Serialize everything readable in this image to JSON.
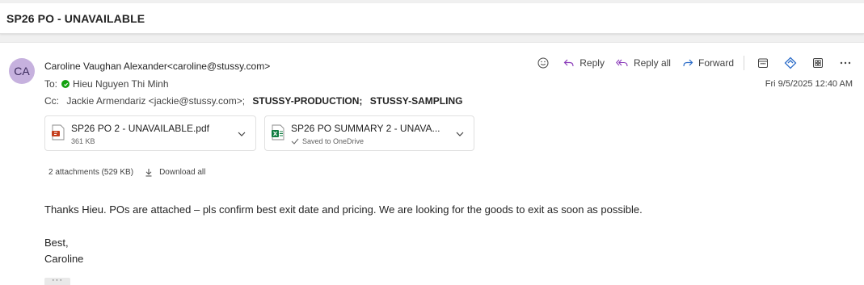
{
  "subject": "SP26 PO - UNAVAILABLE",
  "sender": {
    "initials": "CA",
    "display": "Caroline Vaughan Alexander<caroline@stussy.com>"
  },
  "to": {
    "label": "To:",
    "name": "Hieu Nguyen Thi Minh"
  },
  "cc": {
    "label": "Cc:",
    "recipients": [
      "Jackie Armendariz <jackie@stussy.com>;",
      "STUSSY-PRODUCTION;",
      "STUSSY-SAMPLING"
    ]
  },
  "actions": {
    "reply": "Reply",
    "reply_all": "Reply all",
    "forward": "Forward",
    "more": "..."
  },
  "date": "Fri 9/5/2025 12:40 AM",
  "attachments": [
    {
      "name": "SP26 PO 2 - UNAVAILABLE.pdf",
      "sub": "361 KB",
      "type": "pdf"
    },
    {
      "name": "SP26 PO SUMMARY 2 - UNAVA...",
      "sub": "Saved to OneDrive",
      "type": "xlsx"
    }
  ],
  "attachments_summary": "2 attachments (529 KB)",
  "download_all": "Download all",
  "body": {
    "line1": "Thanks Hieu. POs are attached – pls confirm best exit date and pricing. We are looking for the goods to exit as soon as possible.",
    "line2": "Best,",
    "line3": "Caroline"
  },
  "show_more": "···",
  "colors": {
    "avatar_bg": "#c6b1de",
    "presence": "#13a10e",
    "accent_icon": "#2b6cc8",
    "pdf_red": "#c43e1c",
    "excel_green": "#107c41"
  }
}
